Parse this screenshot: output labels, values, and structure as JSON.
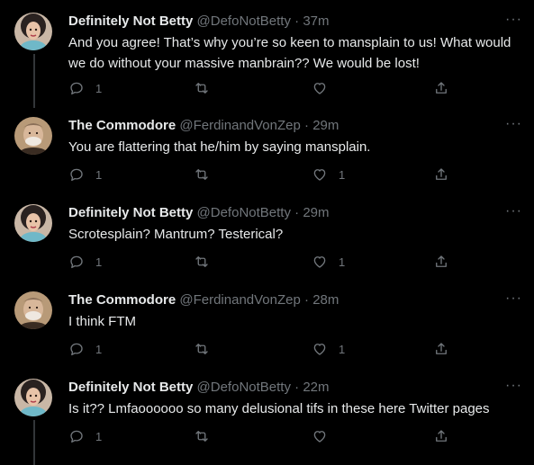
{
  "colors": {
    "background": "#000000",
    "text": "#e7e9ea",
    "muted": "#71767b",
    "thread_line": "#333639"
  },
  "tweets": [
    {
      "name": "Definitely Not Betty",
      "handle": "@DefoNotBetty",
      "separator": "·",
      "time": "37m",
      "avatar": "betty-avatar",
      "text": "And you agree! That’s why you’re so keen to mansplain to us! What would we do without your massive manbrain?? We would be lost!",
      "reply_count": "1",
      "retweet_count": "",
      "like_count": ""
    },
    {
      "name": "The Commodore",
      "handle": "@FerdinandVonZep",
      "separator": "·",
      "time": "29m",
      "avatar": "commodore-avatar",
      "text": "You are flattering that he/him by saying mansplain.",
      "reply_count": "1",
      "retweet_count": "",
      "like_count": "1"
    },
    {
      "name": "Definitely Not Betty",
      "handle": "@DefoNotBetty",
      "separator": "·",
      "time": "29m",
      "avatar": "betty-avatar",
      "text": "Scrotesplain? Mantrum? Testerical?",
      "reply_count": "1",
      "retweet_count": "",
      "like_count": "1"
    },
    {
      "name": "The Commodore",
      "handle": "@FerdinandVonZep",
      "separator": "·",
      "time": "28m",
      "avatar": "commodore-avatar",
      "text": "I think FTM",
      "reply_count": "1",
      "retweet_count": "",
      "like_count": "1"
    },
    {
      "name": "Definitely Not Betty",
      "handle": "@DefoNotBetty",
      "separator": "·",
      "time": "22m",
      "avatar": "betty-avatar",
      "text": "Is it?? Lmfaoooooo so many delusional tifs in these here Twitter pages",
      "reply_count": "1",
      "retweet_count": "",
      "like_count": ""
    }
  ]
}
